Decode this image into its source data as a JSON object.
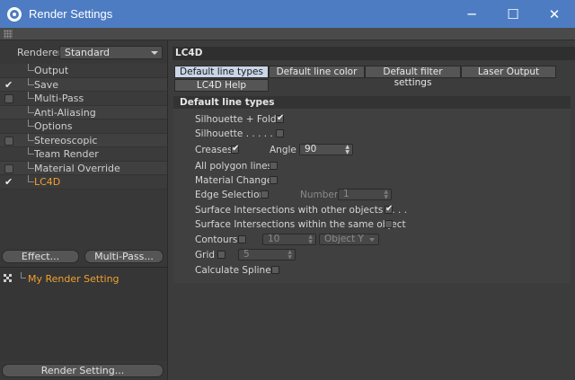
{
  "window": {
    "title": "Render Settings",
    "minimize_glyph": "─",
    "maximize_glyph": "☐",
    "close_glyph": "✕"
  },
  "left": {
    "renderer_label": "Renderer",
    "renderer_value": "Standard",
    "tree_items": [
      {
        "label": "Output",
        "check": "none",
        "active": false
      },
      {
        "label": "Save",
        "check": "tick",
        "active": false
      },
      {
        "label": "Multi-Pass",
        "check": "box",
        "active": false
      },
      {
        "label": "Anti-Aliasing",
        "check": "none",
        "active": false
      },
      {
        "label": "Options",
        "check": "none",
        "active": false
      },
      {
        "label": "Stereoscopic",
        "check": "box",
        "active": false
      },
      {
        "label": "Team Render",
        "check": "none",
        "active": false
      },
      {
        "label": "Material Override",
        "check": "box",
        "active": false
      },
      {
        "label": "LC4D",
        "check": "tick",
        "active": true
      }
    ],
    "effect_button": "Effect...",
    "multipass_button": "Multi-Pass...",
    "render_setting_item": "My Render Setting",
    "render_setting_button": "Render Setting..."
  },
  "right": {
    "header": "LC4D",
    "tabs": [
      {
        "label": "Default line types",
        "active": true
      },
      {
        "label": "Default line color",
        "active": false
      },
      {
        "label": "Default filter settings",
        "active": false
      },
      {
        "label": "Laser Output",
        "active": false
      },
      {
        "label": "LC4D Help",
        "active": false
      }
    ],
    "group_title": "Default line types",
    "params": {
      "silhouette_folds": {
        "label": "Silhouette + Folds",
        "checked": true
      },
      "silhouette": {
        "label": "Silhouette . . . . . . .",
        "checked": false
      },
      "creases": {
        "label": "Creases",
        "checked": true
      },
      "angle_label": "Angle",
      "angle_value": "90",
      "all_polygon_lines": {
        "label": "All polygon lines",
        "checked": false
      },
      "material_change": {
        "label": "Material Change",
        "checked": false
      },
      "edge_selection": {
        "label": "Edge Selection",
        "checked": false
      },
      "number_label": "Number",
      "number_value": "1",
      "surface_other": {
        "label": "Surface Intersections with other objects . . . .",
        "checked": true
      },
      "surface_same": {
        "label": "Surface Intersections within the same object",
        "checked": false
      },
      "contours": {
        "label": "Contours",
        "checked": false
      },
      "contours_value": "10",
      "contours_axis": "Object Y",
      "grid": {
        "label": "Grid",
        "checked": false
      },
      "grid_value": "5",
      "calculate_splines": {
        "label": "Calculate Splines",
        "checked": false
      }
    }
  }
}
